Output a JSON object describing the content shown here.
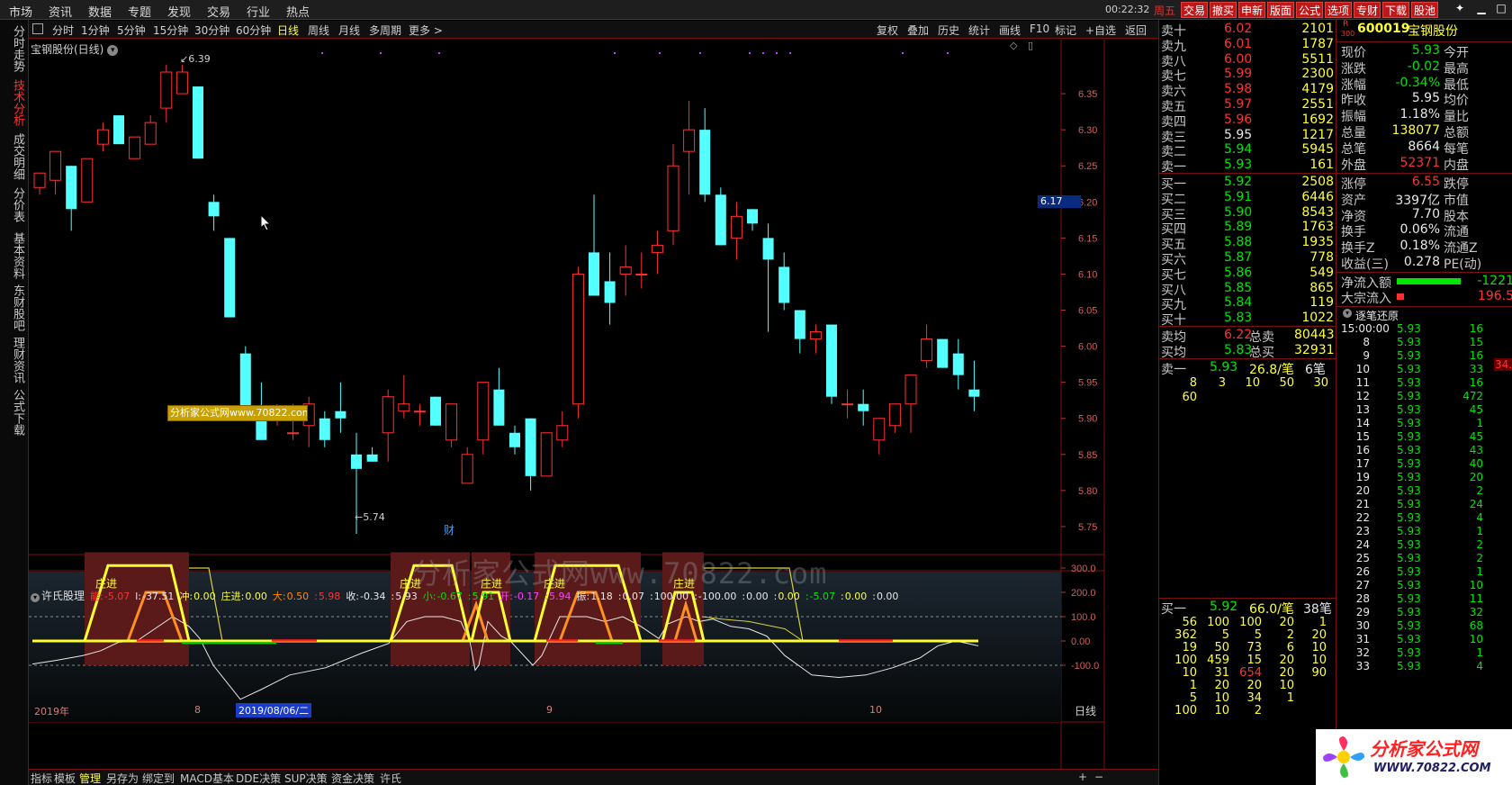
{
  "topmenu": [
    "市场",
    "资讯",
    "数据",
    "专题",
    "发现",
    "交易",
    "行业",
    "热点"
  ],
  "clock": "00:22:32",
  "weekday": "周五",
  "trade_buttons": [
    "交易",
    "撤买",
    "申新",
    "版面",
    "公式",
    "选项",
    "专财",
    "下载",
    "股池"
  ],
  "sidebar": [
    {
      "label": "分时走势",
      "active": false
    },
    {
      "label": "技术分析",
      "active": true
    },
    {
      "label": "成交明细",
      "active": false
    },
    {
      "label": "分价表",
      "active": false
    },
    {
      "label": "基本资料",
      "active": false
    },
    {
      "label": "东财股吧",
      "active": false
    },
    {
      "label": "理财资讯",
      "active": false
    },
    {
      "label": "公式下载",
      "active": false
    }
  ],
  "periods": [
    "分时",
    "1分钟",
    "5分钟",
    "15分钟",
    "30分钟",
    "60分钟",
    "日线",
    "周线",
    "月线",
    "多周期",
    "更多 >"
  ],
  "selected_period": "日线",
  "toolbar_right": [
    "复权",
    "叠加",
    "历史",
    "统计",
    "画线",
    "F10",
    "标记",
    "+自选",
    "返回"
  ],
  "stock_title": "宝钢股份(日线)",
  "price_axis": [
    "6.35",
    "6.30",
    "6.25",
    "6.20",
    "6.15",
    "6.10",
    "6.05",
    "6.00",
    "5.95",
    "5.90",
    "5.85",
    "5.80",
    "5.75"
  ],
  "current_price_tag": "6.17",
  "high_label": "6.39",
  "low_label": "5.74",
  "cai_marker": "财",
  "watermark_small": "分析家公式网www.70822.com",
  "watermark_big": "分析家公式网www.70822.com",
  "indicator": {
    "name": "许氏股理",
    "items": [
      {
        "label": "能:",
        "value": "-5.07",
        "color": "#ff3232"
      },
      {
        "label": "l:",
        "value": "-37.51",
        "color": "#e8e8e8"
      },
      {
        "label": "冲:",
        "value": "0.00",
        "color": "#ffff40"
      },
      {
        "label": "庄进:",
        "value": "0.00",
        "color": "#ffff40"
      },
      {
        "label": "大:",
        "value": "0.50",
        "color": "#ff8c00"
      },
      {
        "label": ":",
        "value": "5.98",
        "color": "#ff3232"
      },
      {
        "label": "收:",
        "value": "-0.34",
        "color": "#e8e8e8"
      },
      {
        "label": ":",
        "value": "5.93",
        "color": "#e8e8e8"
      },
      {
        "label": "小:",
        "value": "-0.67",
        "color": "#00e600"
      },
      {
        "label": ":",
        "value": "5.91",
        "color": "#00e600"
      },
      {
        "label": "开:",
        "value": "-0.17",
        "color": "#ff40ff"
      },
      {
        "label": ":",
        "value": "5.94",
        "color": "#ff40ff"
      },
      {
        "label": "振:",
        "value": "1.18",
        "color": "#e8e8e8"
      },
      {
        "label": ":",
        "value": "0.07",
        "color": "#e8e8e8"
      },
      {
        "label": ":",
        "value": "100.00",
        "color": "#e8e8e8"
      },
      {
        "label": ":",
        "value": "-100.00",
        "color": "#e8e8e8"
      },
      {
        "label": ":",
        "value": "0.00",
        "color": "#e8e8e8"
      },
      {
        "label": ":",
        "value": "0.00",
        "color": "#ffff40"
      },
      {
        "label": ":",
        "value": "-5.07",
        "color": "#00e600"
      },
      {
        "label": ":",
        "value": "0.00",
        "color": "#ffff40"
      },
      {
        "label": ":",
        "value": "0.00",
        "color": "#e8e8e8"
      }
    ],
    "axis": [
      "300.0",
      "200.0",
      "100.0",
      "0.00",
      "-100.0"
    ],
    "zone_label": "庄进"
  },
  "date_axis": {
    "year": "2019年",
    "m8": "8",
    "selected": "2019/08/06/二",
    "m9": "9",
    "m10": "10",
    "period": "日线"
  },
  "bottom_tabs": [
    "指标",
    "模板",
    "管理",
    "另存为",
    "绑定到",
    "MACD基本",
    "DDE决策",
    "SUP决策",
    "资金决策",
    "许氏"
  ],
  "bottom_selected": "管理",
  "quote": {
    "code": "600019",
    "name": "宝钢股份",
    "market_tag": "R",
    "market_num": "300",
    "asks": [
      {
        "label": "卖十",
        "price": "6.02",
        "vol": "2101"
      },
      {
        "label": "卖九",
        "price": "6.01",
        "vol": "1787"
      },
      {
        "label": "卖八",
        "price": "6.00",
        "vol": "5511"
      },
      {
        "label": "卖七",
        "price": "5.99",
        "vol": "2300"
      },
      {
        "label": "卖六",
        "price": "5.98",
        "vol": "4179"
      },
      {
        "label": "卖五",
        "price": "5.97",
        "vol": "2551"
      },
      {
        "label": "卖四",
        "price": "5.96",
        "vol": "1692"
      },
      {
        "label": "卖三",
        "price": "5.95",
        "vol": "1217"
      },
      {
        "label": "卖二",
        "price": "5.94",
        "vol": "5945"
      },
      {
        "label": "卖一",
        "price": "5.93",
        "vol": "161"
      }
    ],
    "bids": [
      {
        "label": "买一",
        "price": "5.92",
        "vol": "2508"
      },
      {
        "label": "买二",
        "price": "5.91",
        "vol": "6446"
      },
      {
        "label": "买三",
        "price": "5.90",
        "vol": "8543"
      },
      {
        "label": "买四",
        "price": "5.89",
        "vol": "1763"
      },
      {
        "label": "买五",
        "price": "5.88",
        "vol": "1935"
      },
      {
        "label": "买六",
        "price": "5.87",
        "vol": "778"
      },
      {
        "label": "买七",
        "price": "5.86",
        "vol": "549"
      },
      {
        "label": "买八",
        "price": "5.85",
        "vol": "865"
      },
      {
        "label": "买九",
        "price": "5.84",
        "vol": "119"
      },
      {
        "label": "买十",
        "price": "5.83",
        "vol": "1022"
      }
    ],
    "avg": [
      {
        "label": "卖均",
        "price": "6.22",
        "tlabel": "总卖",
        "vol": "80443"
      },
      {
        "label": "买均",
        "price": "5.83",
        "tlabel": "总买",
        "vol": "32931"
      }
    ],
    "sell1_row": {
      "label": "卖一",
      "price": "5.93",
      "per": "26.8/笔",
      "cnt": "6笔"
    },
    "sell1_queue": [
      "8",
      "3",
      "10",
      "50",
      "30",
      "60"
    ],
    "buy1_row": {
      "label": "买一",
      "price": "5.92",
      "per": "66.0/笔",
      "cnt": "38笔"
    },
    "buy1_queue": [
      [
        "56",
        "100",
        "100",
        "20",
        "1"
      ],
      [
        "362",
        "5",
        "5",
        "2",
        "20"
      ],
      [
        "19",
        "50",
        "73",
        "6",
        "10"
      ],
      [
        "100",
        "459",
        "15",
        "20",
        "10"
      ],
      [
        "10",
        "31",
        "654",
        "20",
        "90"
      ],
      [
        "1",
        "20",
        "20",
        "10",
        ""
      ],
      [
        "5",
        "10",
        "34",
        "1",
        ""
      ],
      [
        "100",
        "10",
        "2",
        "",
        ""
      ]
    ],
    "stats": [
      {
        "l1": "现价",
        "v1": "5.93",
        "c1": "grn",
        "l2": "今开"
      },
      {
        "l1": "涨跌",
        "v1": "-0.02",
        "c1": "grn",
        "l2": "最高"
      },
      {
        "l1": "涨幅",
        "v1": "-0.34%",
        "c1": "grn",
        "l2": "最低"
      },
      {
        "l1": "昨收",
        "v1": "5.95",
        "c1": "wht",
        "l2": "均价"
      },
      {
        "l1": "振幅",
        "v1": "1.18%",
        "c1": "wht",
        "l2": "量比"
      },
      {
        "l1": "总量",
        "v1": "138077",
        "c1": "yel",
        "l2": "总额"
      },
      {
        "l1": "总笔",
        "v1": "8664",
        "c1": "wht",
        "l2": "每笔"
      },
      {
        "l1": "外盘",
        "v1": "52371",
        "c1": "red",
        "l2": "内盘"
      }
    ],
    "stats2": [
      {
        "l1": "涨停",
        "v1": "6.55",
        "c1": "red",
        "l2": "跌停"
      },
      {
        "l1": "资产",
        "v1": "3397亿",
        "c1": "wht",
        "l2": "市值"
      },
      {
        "l1": "净资",
        "v1": "7.70",
        "c1": "wht",
        "l2": "股本"
      },
      {
        "l1": "换手",
        "v1": "0.06%",
        "c1": "wht",
        "l2": "流通"
      },
      {
        "l1": "换手Z",
        "v1": "0.18%",
        "c1": "wht",
        "l2": "流通Z"
      },
      {
        "l1": "收益(三)",
        "v1": "0.278",
        "c1": "wht",
        "l2": "PE(动)"
      }
    ],
    "flow": [
      {
        "label": "净流入额",
        "value": "-1221",
        "color": "#00e600",
        "bar": 0.85
      },
      {
        "label": "大宗流入",
        "value": "196.5",
        "color": "#ff3232",
        "bar": 0.1
      }
    ],
    "tick_title": "逐笔还原",
    "tick_side_value": "34.",
    "ticks": [
      {
        "t": "15:00:00",
        "p": "5.93",
        "v": "16"
      },
      {
        "t": "8",
        "p": "5.93",
        "v": "15"
      },
      {
        "t": "9",
        "p": "5.93",
        "v": "16"
      },
      {
        "t": "10",
        "p": "5.93",
        "v": "33"
      },
      {
        "t": "11",
        "p": "5.93",
        "v": "16"
      },
      {
        "t": "12",
        "p": "5.93",
        "v": "472"
      },
      {
        "t": "13",
        "p": "5.93",
        "v": "45"
      },
      {
        "t": "14",
        "p": "5.93",
        "v": "1"
      },
      {
        "t": "15",
        "p": "5.93",
        "v": "45"
      },
      {
        "t": "16",
        "p": "5.93",
        "v": "43"
      },
      {
        "t": "17",
        "p": "5.93",
        "v": "40"
      },
      {
        "t": "19",
        "p": "5.93",
        "v": "20"
      },
      {
        "t": "20",
        "p": "5.93",
        "v": "2"
      },
      {
        "t": "21",
        "p": "5.93",
        "v": "24"
      },
      {
        "t": "22",
        "p": "5.93",
        "v": "4"
      },
      {
        "t": "23",
        "p": "5.93",
        "v": "1"
      },
      {
        "t": "24",
        "p": "5.93",
        "v": "2"
      },
      {
        "t": "25",
        "p": "5.93",
        "v": "2"
      },
      {
        "t": "26",
        "p": "5.93",
        "v": "1"
      },
      {
        "t": "27",
        "p": "5.93",
        "v": "10"
      },
      {
        "t": "28",
        "p": "5.93",
        "v": "11"
      },
      {
        "t": "29",
        "p": "5.93",
        "v": "32"
      },
      {
        "t": "30",
        "p": "5.93",
        "v": "68"
      },
      {
        "t": "31",
        "p": "5.93",
        "v": "10"
      },
      {
        "t": "32",
        "p": "5.93",
        "v": "1"
      },
      {
        "t": "33",
        "p": "5.93",
        "v": "4"
      }
    ]
  },
  "logo": {
    "line1": "分析家公式网",
    "line2": "WWW.70822.COM"
  },
  "chart_data": {
    "type": "candlestick",
    "ylim": [
      5.72,
      6.4
    ],
    "up_color": "#ff3232",
    "down_color": "#54ffff",
    "candles": [
      {
        "o": 6.22,
        "h": 6.24,
        "l": 6.21,
        "c": 6.24
      },
      {
        "o": 6.23,
        "h": 6.27,
        "l": 6.21,
        "c": 6.27
      },
      {
        "o": 6.25,
        "h": 6.25,
        "l": 6.16,
        "c": 6.19
      },
      {
        "o": 6.2,
        "h": 6.26,
        "l": 6.2,
        "c": 6.26
      },
      {
        "o": 6.28,
        "h": 6.31,
        "l": 6.27,
        "c": 6.3
      },
      {
        "o": 6.32,
        "h": 6.32,
        "l": 6.28,
        "c": 6.28
      },
      {
        "o": 6.26,
        "h": 6.29,
        "l": 6.26,
        "c": 6.29
      },
      {
        "o": 6.28,
        "h": 6.32,
        "l": 6.28,
        "c": 6.31
      },
      {
        "o": 6.33,
        "h": 6.39,
        "l": 6.31,
        "c": 6.38
      },
      {
        "o": 6.35,
        "h": 6.39,
        "l": 6.35,
        "c": 6.38
      },
      {
        "o": 6.36,
        "h": 6.36,
        "l": 6.26,
        "c": 6.26
      },
      {
        "o": 6.2,
        "h": 6.21,
        "l": 6.16,
        "c": 6.18
      },
      {
        "o": 6.15,
        "h": 6.15,
        "l": 6.04,
        "c": 6.04
      },
      {
        "o": 5.99,
        "h": 6.0,
        "l": 5.91,
        "c": 5.91
      },
      {
        "o": 5.91,
        "h": 5.95,
        "l": 5.87,
        "c": 5.87
      },
      {
        "o": 5.9,
        "h": 5.92,
        "l": 5.89,
        "c": 5.91
      },
      {
        "o": 5.88,
        "h": 5.92,
        "l": 5.87,
        "c": 5.88
      },
      {
        "o": 5.89,
        "h": 5.93,
        "l": 5.86,
        "c": 5.92
      },
      {
        "o": 5.9,
        "h": 5.91,
        "l": 5.86,
        "c": 5.87
      },
      {
        "o": 5.91,
        "h": 5.95,
        "l": 5.88,
        "c": 5.9
      },
      {
        "o": 5.85,
        "h": 5.88,
        "l": 5.74,
        "c": 5.83
      },
      {
        "o": 5.85,
        "h": 5.86,
        "l": 5.84,
        "c": 5.84
      },
      {
        "o": 5.88,
        "h": 5.94,
        "l": 5.84,
        "c": 5.93
      },
      {
        "o": 5.91,
        "h": 5.96,
        "l": 5.9,
        "c": 5.92
      },
      {
        "o": 5.91,
        "h": 5.92,
        "l": 5.89,
        "c": 5.91
      },
      {
        "o": 5.93,
        "h": 5.93,
        "l": 5.89,
        "c": 5.89
      },
      {
        "o": 5.87,
        "h": 5.91,
        "l": 5.86,
        "c": 5.92
      },
      {
        "o": 5.81,
        "h": 5.86,
        "l": 5.81,
        "c": 5.85
      },
      {
        "o": 5.87,
        "h": 5.95,
        "l": 5.85,
        "c": 5.95
      },
      {
        "o": 5.94,
        "h": 5.97,
        "l": 5.89,
        "c": 5.89
      },
      {
        "o": 5.88,
        "h": 5.89,
        "l": 5.85,
        "c": 5.86
      },
      {
        "o": 5.9,
        "h": 5.9,
        "l": 5.8,
        "c": 5.82
      },
      {
        "o": 5.82,
        "h": 5.88,
        "l": 5.82,
        "c": 5.88
      },
      {
        "o": 5.87,
        "h": 5.91,
        "l": 5.86,
        "c": 5.89
      },
      {
        "o": 5.92,
        "h": 6.11,
        "l": 5.9,
        "c": 6.1
      },
      {
        "o": 6.13,
        "h": 6.21,
        "l": 6.07,
        "c": 6.07
      },
      {
        "o": 6.09,
        "h": 6.13,
        "l": 6.03,
        "c": 6.06
      },
      {
        "o": 6.1,
        "h": 6.14,
        "l": 6.07,
        "c": 6.11
      },
      {
        "o": 6.1,
        "h": 6.13,
        "l": 6.08,
        "c": 6.1
      },
      {
        "o": 6.13,
        "h": 6.16,
        "l": 6.1,
        "c": 6.14
      },
      {
        "o": 6.16,
        "h": 6.28,
        "l": 6.14,
        "c": 6.25
      },
      {
        "o": 6.27,
        "h": 6.34,
        "l": 6.21,
        "c": 6.3
      },
      {
        "o": 6.3,
        "h": 6.33,
        "l": 6.2,
        "c": 6.21
      },
      {
        "o": 6.21,
        "h": 6.22,
        "l": 6.14,
        "c": 6.14
      },
      {
        "o": 6.15,
        "h": 6.2,
        "l": 6.12,
        "c": 6.18
      },
      {
        "o": 6.19,
        "h": 6.19,
        "l": 6.16,
        "c": 6.17
      },
      {
        "o": 6.15,
        "h": 6.17,
        "l": 6.02,
        "c": 6.12
      },
      {
        "o": 6.11,
        "h": 6.13,
        "l": 6.05,
        "c": 6.06
      },
      {
        "o": 6.05,
        "h": 6.05,
        "l": 5.99,
        "c": 6.01
      },
      {
        "o": 6.01,
        "h": 6.03,
        "l": 5.99,
        "c": 6.02
      },
      {
        "o": 6.03,
        "h": 6.03,
        "l": 5.92,
        "c": 5.93
      },
      {
        "o": 5.92,
        "h": 5.94,
        "l": 5.9,
        "c": 5.92
      },
      {
        "o": 5.92,
        "h": 5.94,
        "l": 5.89,
        "c": 5.91
      },
      {
        "o": 5.87,
        "h": 5.9,
        "l": 5.85,
        "c": 5.9
      },
      {
        "o": 5.89,
        "h": 5.92,
        "l": 5.88,
        "c": 5.92
      },
      {
        "o": 5.92,
        "h": 5.96,
        "l": 5.88,
        "c": 5.96
      },
      {
        "o": 5.98,
        "h": 6.03,
        "l": 5.97,
        "c": 6.01
      },
      {
        "o": 6.01,
        "h": 6.01,
        "l": 5.97,
        "c": 5.97
      },
      {
        "o": 5.99,
        "h": 6.01,
        "l": 5.94,
        "c": 5.96
      },
      {
        "o": 5.94,
        "h": 5.98,
        "l": 5.91,
        "c": 5.93
      }
    ]
  }
}
